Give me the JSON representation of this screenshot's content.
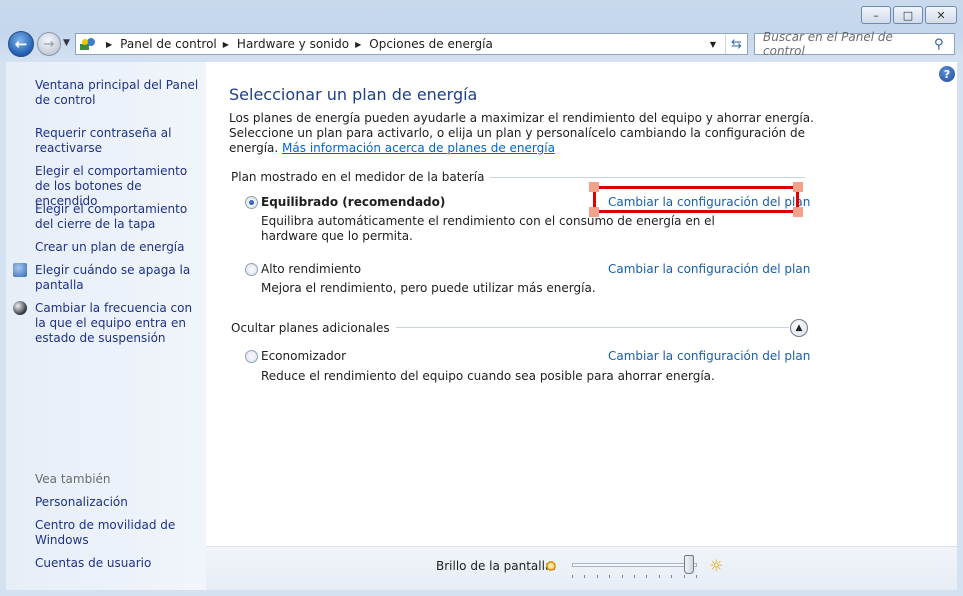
{
  "window": {
    "buttons": {
      "minimize": "–",
      "maximize": "□",
      "close": "✕"
    }
  },
  "nav": {
    "breadcrumbs": [
      "Panel de control",
      "Hardware y sonido",
      "Opciones de energía"
    ],
    "search_placeholder": "Buscar en el Panel de control"
  },
  "sidebar": {
    "items": [
      {
        "label": "Ventana principal del Panel de control"
      },
      {
        "label": "Requerir contraseña al reactivarse"
      },
      {
        "label": "Elegir el comportamiento de los botones de encendido"
      },
      {
        "label": "Elegir el comportamiento del cierre de la tapa"
      },
      {
        "label": "Crear un plan de energía"
      },
      {
        "label": "Elegir cuándo se apaga la pantalla"
      },
      {
        "label": "Cambiar la frecuencia con la que el equipo entra en estado de suspensión"
      }
    ],
    "see_also_title": "Vea también",
    "see_also": [
      {
        "label": "Personalización"
      },
      {
        "label": "Centro de movilidad de Windows"
      },
      {
        "label": "Cuentas de usuario"
      }
    ]
  },
  "main": {
    "title": "Seleccionar un plan de energía",
    "intro": "Los planes de energía pueden ayudarle a maximizar el rendimiento del equipo y ahorrar energía. Seleccione un plan para activarlo, o elija un plan y personalícelo cambiando la configuración de energía.",
    "more_info_link": "Más información acerca de planes de energía",
    "battery_section_title": "Plan mostrado en el medidor de la batería",
    "hidden_section_title": "Ocultar planes adicionales",
    "change_link_label": "Cambiar la configuración del plan",
    "plans": [
      {
        "name": "Equilibrado (recomendado)",
        "desc": "Equilibra automáticamente el rendimiento con el consumo de energía en el hardware que lo permita.",
        "selected": true
      },
      {
        "name": "Alto rendimiento",
        "desc": "Mejora el rendimiento, pero puede utilizar más energía.",
        "selected": false
      },
      {
        "name": "Economizador",
        "desc": "Reduce el rendimiento del equipo cuando sea posible para ahorrar energía.",
        "selected": false
      }
    ]
  },
  "bottom": {
    "brightness_label": "Brillo de la pantalla:",
    "brightness_level": 1.0
  },
  "colors": {
    "link": "#1a5fa8",
    "title": "#1e3f8a",
    "highlight": "#e00000"
  }
}
